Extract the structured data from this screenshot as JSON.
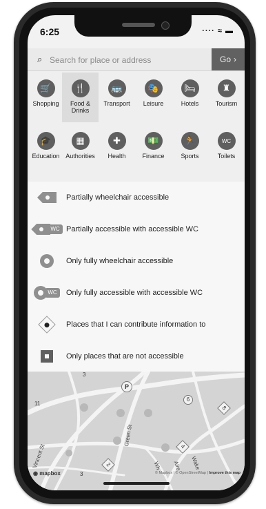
{
  "status": {
    "time": "6:25",
    "indicators": "···· ≈ ▬"
  },
  "search": {
    "placeholder": "Search for place or address",
    "go_label": "Go"
  },
  "categories": [
    {
      "label": "Shopping",
      "icon": "shopping-cart-icon",
      "glyph": "🛒",
      "selected": false
    },
    {
      "label": "Food & Drinks",
      "icon": "fork-knife-icon",
      "glyph": "🍴",
      "selected": true
    },
    {
      "label": "Transport",
      "icon": "bus-icon",
      "glyph": "🚌",
      "selected": false
    },
    {
      "label": "Leisure",
      "icon": "theater-masks-icon",
      "glyph": "🎭",
      "selected": false
    },
    {
      "label": "Hotels",
      "icon": "bed-icon",
      "glyph": "🛏",
      "selected": false
    },
    {
      "label": "Tourism",
      "icon": "tower-icon",
      "glyph": "♜",
      "selected": false
    },
    {
      "label": "Education",
      "icon": "graduation-cap-icon",
      "glyph": "🎓",
      "selected": false
    },
    {
      "label": "Authorities",
      "icon": "building-icon",
      "glyph": "▦",
      "selected": false
    },
    {
      "label": "Health",
      "icon": "plus-icon",
      "glyph": "✚",
      "selected": false
    },
    {
      "label": "Finance",
      "icon": "banknote-icon",
      "glyph": "💵",
      "selected": false
    },
    {
      "label": "Sports",
      "icon": "runner-icon",
      "glyph": "🏃",
      "selected": false
    },
    {
      "label": "Toilets",
      "icon": "wc-icon",
      "glyph": "WC",
      "selected": false
    }
  ],
  "legend": [
    {
      "label": "Partially wheelchair accessible",
      "icon": "partial-tag-icon"
    },
    {
      "label": "Partially accessible with accessible WC",
      "icon": "partial-wc-tag-icon"
    },
    {
      "label": "Only fully wheelchair accessible",
      "icon": "full-ring-icon"
    },
    {
      "label": "Only fully accessible with accessible WC",
      "icon": "full-wc-ring-icon"
    },
    {
      "label": "Places that I can contribute information to",
      "icon": "diamond-dot-icon"
    },
    {
      "label": "Only places that are not accessible",
      "icon": "square-icon"
    }
  ],
  "map": {
    "logo": "mapbox",
    "attribution": "© Mapbox | © OpenStreetMap |",
    "improve": "Improve this map",
    "streets": [
      "Vincent St",
      "Green St",
      "Wh",
      "Aire",
      "Wake"
    ],
    "markers": [
      "3",
      "P",
      "11",
      "6",
      "8",
      "4",
      "2",
      "3"
    ]
  },
  "colors": {
    "accent_dark": "#5f5f5f",
    "map_bg": "#d4d4d4"
  }
}
